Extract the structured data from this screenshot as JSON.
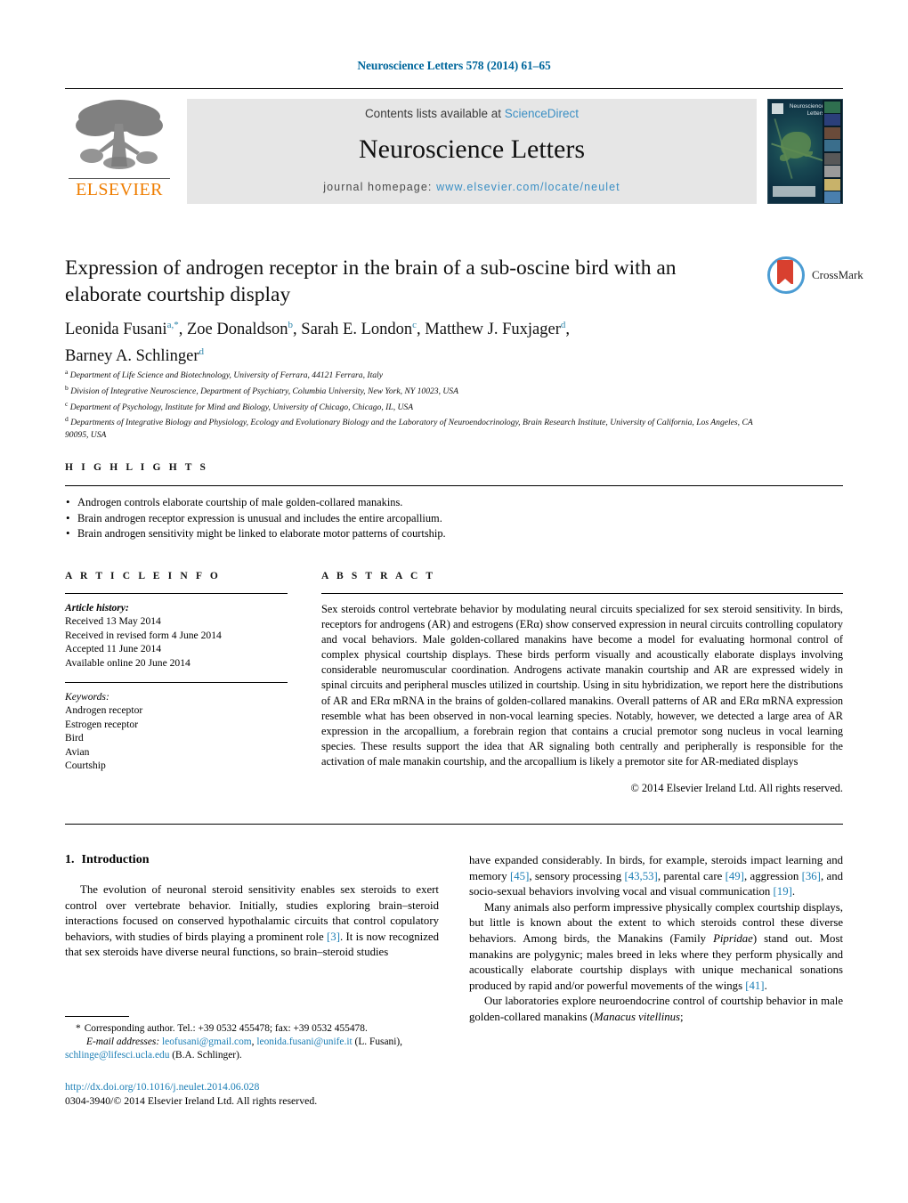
{
  "running_head": "Neuroscience Letters 578 (2014) 61–65",
  "masthead": {
    "contents_prefix": "Contents lists available at ",
    "contents_link": "ScienceDirect",
    "journal_name": "Neuroscience Letters",
    "homepage_prefix": "journal homepage: ",
    "homepage_url": "www.elsevier.com/locate/neulet",
    "publisher_wordmark": "ELSEVIER",
    "cover_title": "Neuroscience Letters",
    "accent_color": "#3b8fc4",
    "elsevier_orange": "#ef7d00"
  },
  "article": {
    "title": "Expression of androgen receptor in the brain of a sub-oscine bird with an elaborate courtship display",
    "crossmark_label": "CrossMark",
    "authors": [
      {
        "name": "Leonida Fusani",
        "marks": "a,*"
      },
      {
        "name": "Zoe Donaldson",
        "marks": "b"
      },
      {
        "name": "Sarah E. London",
        "marks": "c"
      },
      {
        "name": "Matthew J. Fuxjager",
        "marks": "d"
      },
      {
        "name": "Barney A. Schlinger",
        "marks": "d"
      }
    ],
    "affiliations": [
      {
        "mark": "a",
        "text": "Department of Life Science and Biotechnology, University of Ferrara, 44121 Ferrara, Italy"
      },
      {
        "mark": "b",
        "text": "Division of Integrative Neuroscience, Department of Psychiatry, Columbia University, New York, NY 10023, USA"
      },
      {
        "mark": "c",
        "text": "Department of Psychology, Institute for Mind and Biology, University of Chicago, Chicago, IL, USA"
      },
      {
        "mark": "d",
        "text": "Departments of Integrative Biology and Physiology, Ecology and Evolutionary Biology and the Laboratory of Neuroendocrinology, Brain Research Institute, University of California, Los Angeles, CA 90095, USA"
      }
    ]
  },
  "highlights": {
    "heading": "H I G H L I G H T S",
    "items": [
      "Androgen controls elaborate courtship of male golden-collared manakins.",
      "Brain androgen receptor expression is unusual and includes the entire arcopallium.",
      "Brain androgen sensitivity might be linked to elaborate motor patterns of courtship."
    ]
  },
  "article_info": {
    "heading": "A R T I C L E    I N F O",
    "history_label": "Article history:",
    "history": [
      "Received 13 May 2014",
      "Received in revised form 4 June 2014",
      "Accepted 11 June 2014",
      "Available online 20 June 2014"
    ],
    "keywords_label": "Keywords:",
    "keywords": [
      "Androgen receptor",
      "Estrogen receptor",
      "Bird",
      "Avian",
      "Courtship"
    ]
  },
  "abstract": {
    "heading": "A B S T R A C T",
    "text": "Sex steroids control vertebrate behavior by modulating neural circuits specialized for sex steroid sensitivity. In birds, receptors for androgens (AR) and estrogens (ERα) show conserved expression in neural circuits controlling copulatory and vocal behaviors. Male golden-collared manakins have become a model for evaluating hormonal control of complex physical courtship displays. These birds perform visually and acoustically elaborate displays involving considerable neuromuscular coordination. Androgens activate manakin courtship and AR are expressed widely in spinal circuits and peripheral muscles utilized in courtship. Using in situ hybridization, we report here the distributions of AR and ERα mRNA in the brains of golden-collared manakins. Overall patterns of AR and ERα mRNA expression resemble what has been observed in non-vocal learning species. Notably, however, we detected a large area of AR expression in the arcopallium, a forebrain region that contains a crucial premotor song nucleus in vocal learning species. These results support the idea that AR signaling both centrally and peripherally is responsible for the activation of male manakin courtship, and the arcopallium is likely a premotor site for AR-mediated displays",
    "copyright": "© 2014 Elsevier Ireland Ltd. All rights reserved."
  },
  "body": {
    "section_number": "1.",
    "section_title": "Introduction",
    "left_paragraph_parts": [
      "The evolution of neuronal steroid sensitivity enables sex steroids to exert control over vertebrate behavior. Initially, studies exploring brain–steroid interactions focused on conserved hypothalamic circuits that control copulatory behaviors, with studies of birds playing a prominent role ",
      "[3]",
      ". It is now recognized that sex steroids have diverse neural functions, so brain–steroid studies"
    ],
    "right_p1_parts": [
      "have expanded considerably. In birds, for example, steroids impact learning and memory ",
      "[45]",
      ", sensory processing ",
      "[43,53]",
      ", parental care ",
      "[49]",
      ", aggression ",
      "[36]",
      ", and socio-sexual behaviors involving vocal and visual communication ",
      "[19]",
      "."
    ],
    "right_p2_parts": [
      "Many animals also perform impressive physically complex courtship displays, but little is known about the extent to which steroids control these diverse behaviors. Among birds, the Manakins (Family ",
      "Pipridae",
      ") stand out. Most manakins are polygynic; males breed in leks where they perform physically and acoustically elaborate courtship displays with unique mechanical sonations produced by rapid and/or powerful movements of the wings ",
      "[41]",
      "."
    ],
    "right_p3_parts": [
      "Our laboratories explore neuroendocrine control of courtship behavior in male golden-collared manakins (",
      "Manacus vitellinus",
      ";"
    ]
  },
  "footnotes": {
    "corresponding_star": "*",
    "corresponding_text": "Corresponding author. Tel.: +39 0532 455478; fax: +39 0532 455478.",
    "email_label": "E-mail addresses:",
    "emails": [
      {
        "address": "leofusani@gmail.com",
        "sep": ", "
      },
      {
        "address": "leonida.fusani@unife.it",
        "sep": " "
      }
    ],
    "email_owner_1": "(L. Fusani),",
    "email_3": "schlinge@lifesci.ucla.edu",
    "email_owner_2": "(B.A. Schlinger).",
    "doi_url": "http://dx.doi.org/10.1016/j.neulet.2014.06.028",
    "issn_line": "0304-3940/© 2014 Elsevier Ireland Ltd. All rights reserved."
  }
}
